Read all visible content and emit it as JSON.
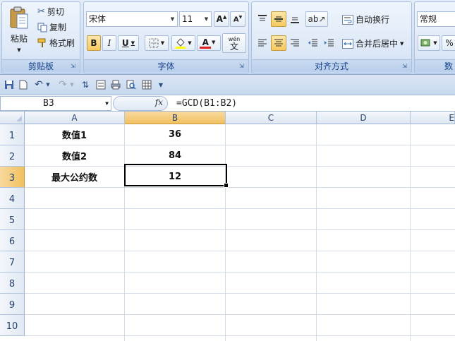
{
  "ribbon": {
    "clipboard": {
      "paste_label": "粘贴",
      "cut_label": "剪切",
      "copy_label": "复制",
      "format_painter_label": "格式刷",
      "group_label": "剪贴板"
    },
    "font": {
      "font_name": "宋体",
      "font_size": "11",
      "bold": "B",
      "italic": "I",
      "underline": "U",
      "font_color_glyph": "A",
      "phonetic_glyph": "wén",
      "phonetic_char": "文",
      "group_label": "字体"
    },
    "alignment": {
      "wrap_text_label": "自动换行",
      "merge_center_label": "合并后居中",
      "group_label": "对齐方式"
    },
    "number": {
      "format_value": "常规",
      "percent_glyph": "%",
      "group_label_partial": "数"
    }
  },
  "formula_bar": {
    "name_box": "B3",
    "fx_label": "fx",
    "formula": "=GCD(B1:B2)"
  },
  "sheet": {
    "columns": [
      "A",
      "B",
      "C",
      "D",
      "E"
    ],
    "rows": [
      "1",
      "2",
      "3",
      "4",
      "5",
      "6",
      "7",
      "8",
      "9",
      "10"
    ],
    "cells": {
      "A1": "数值1",
      "B1": "36",
      "A2": "数值2",
      "B2": "84",
      "A3": "最大公约数",
      "B3": "12"
    },
    "active_cell": "B3"
  },
  "colors": {
    "ribbon_bg": "#d3e1f3",
    "group_label_text": "#15428b",
    "highlight": "#f8c95e",
    "font_color_red": "#e02020"
  }
}
